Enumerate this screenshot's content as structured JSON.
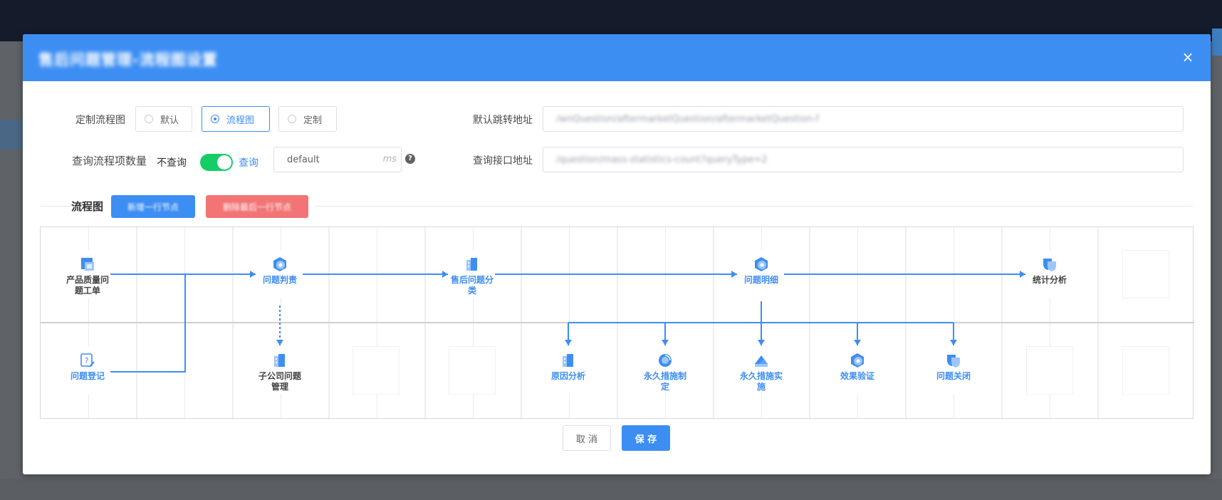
{
  "modal": {
    "title": "售后问题管理-流程图设置",
    "close_glyph": "×"
  },
  "form": {
    "flow_type": {
      "label": "定制流程图",
      "options": [
        "默认",
        "流程图",
        "定制"
      ],
      "selected": "流程图"
    },
    "query_count": {
      "label": "查询流程项数量",
      "off_text": "不查询",
      "on_text": "查询",
      "enabled": true,
      "value": "default",
      "suffix": "ms",
      "help_glyph": "?"
    },
    "default_jump": {
      "label": "默认跳转地址",
      "value": "/wnQuestion/aftermarketQuestion/aftermarketQuestion-f"
    },
    "query_api": {
      "label": "查询接口地址",
      "value": "/question/mass-statistics-count?queryType=2"
    }
  },
  "flowchart": {
    "section_title": "流程图",
    "add_row_label": "新增一行节点",
    "delete_row_label": "删除最后一行节点",
    "nodes": [
      {
        "label": "产品质量问题工单",
        "icon": "form-icon"
      },
      {
        "label": "问题判责",
        "icon": "gear-icon"
      },
      {
        "label": "售后问题分类",
        "icon": "building-icon"
      },
      {
        "label": "问题明细",
        "icon": "gear-icon"
      },
      {
        "label": "统计分析",
        "icon": "shield-icon"
      },
      {
        "label": "问题登记",
        "icon": "question-icon"
      },
      {
        "label": "子公司问题管理",
        "icon": "building-icon"
      },
      {
        "label": "原因分析",
        "icon": "building-icon"
      },
      {
        "label": "永久措施制定",
        "icon": "refresh-icon"
      },
      {
        "label": "永久措施实施",
        "icon": "mountain-icon"
      },
      {
        "label": "效果验证",
        "icon": "gear-icon"
      },
      {
        "label": "问题关闭",
        "icon": "shield-icon"
      }
    ]
  },
  "footer": {
    "cancel_label": "取 消",
    "save_label": "保 存"
  },
  "colors": {
    "primary": "#3d8ef3",
    "danger": "#f27474",
    "switch_on": "#13ce66"
  }
}
